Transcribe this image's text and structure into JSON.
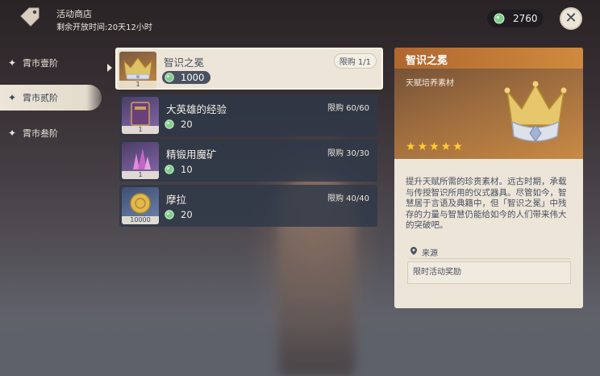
{
  "header": {
    "shop_title": "活动商店",
    "time_remaining": "剩余开放时间:20天12小时"
  },
  "currency": {
    "amount": "2760",
    "icon": "green-gem-icon"
  },
  "tabs": [
    {
      "label": "霄市壹阶",
      "active": false
    },
    {
      "label": "霄市贰阶",
      "active": true
    },
    {
      "label": "霄市叁阶",
      "active": false
    }
  ],
  "items": [
    {
      "name": "智识之冕",
      "limit": "限购 1/1",
      "price": "1000",
      "qty": "1",
      "icon": "crown-icon",
      "selected": true
    },
    {
      "name": "大英雄的经验",
      "limit": "限购 60/60",
      "price": "20",
      "qty": "1",
      "icon": "book-icon",
      "selected": false
    },
    {
      "name": "精锻用魔矿",
      "limit": "限购 30/30",
      "price": "10",
      "qty": "1",
      "icon": "crystal-icon",
      "selected": false
    },
    {
      "name": "摩拉",
      "limit": "限购 40/40",
      "price": "20",
      "qty": "10000",
      "icon": "mora-coin-icon",
      "selected": false
    }
  ],
  "detail": {
    "name": "智识之冕",
    "type": "天赋培养素材",
    "rarity": 5,
    "description": "提升天赋所需的珍贵素材。远古时期，承载与传授智识所用的仪式器具。尽管如今，智慧居于言语及典籍中，但「智识之冕」中残存的力量与智慧仍能给如今的人们带来伟大的突破吧。",
    "source_label": "来源",
    "source": "限时活动奖励"
  },
  "colors": {
    "panel_bg": "#ece5d8",
    "item_bg": "#2e3848",
    "title_orange": "#c07a38",
    "star_gold": "#ffcc32",
    "text_dark": "#4a5161"
  }
}
